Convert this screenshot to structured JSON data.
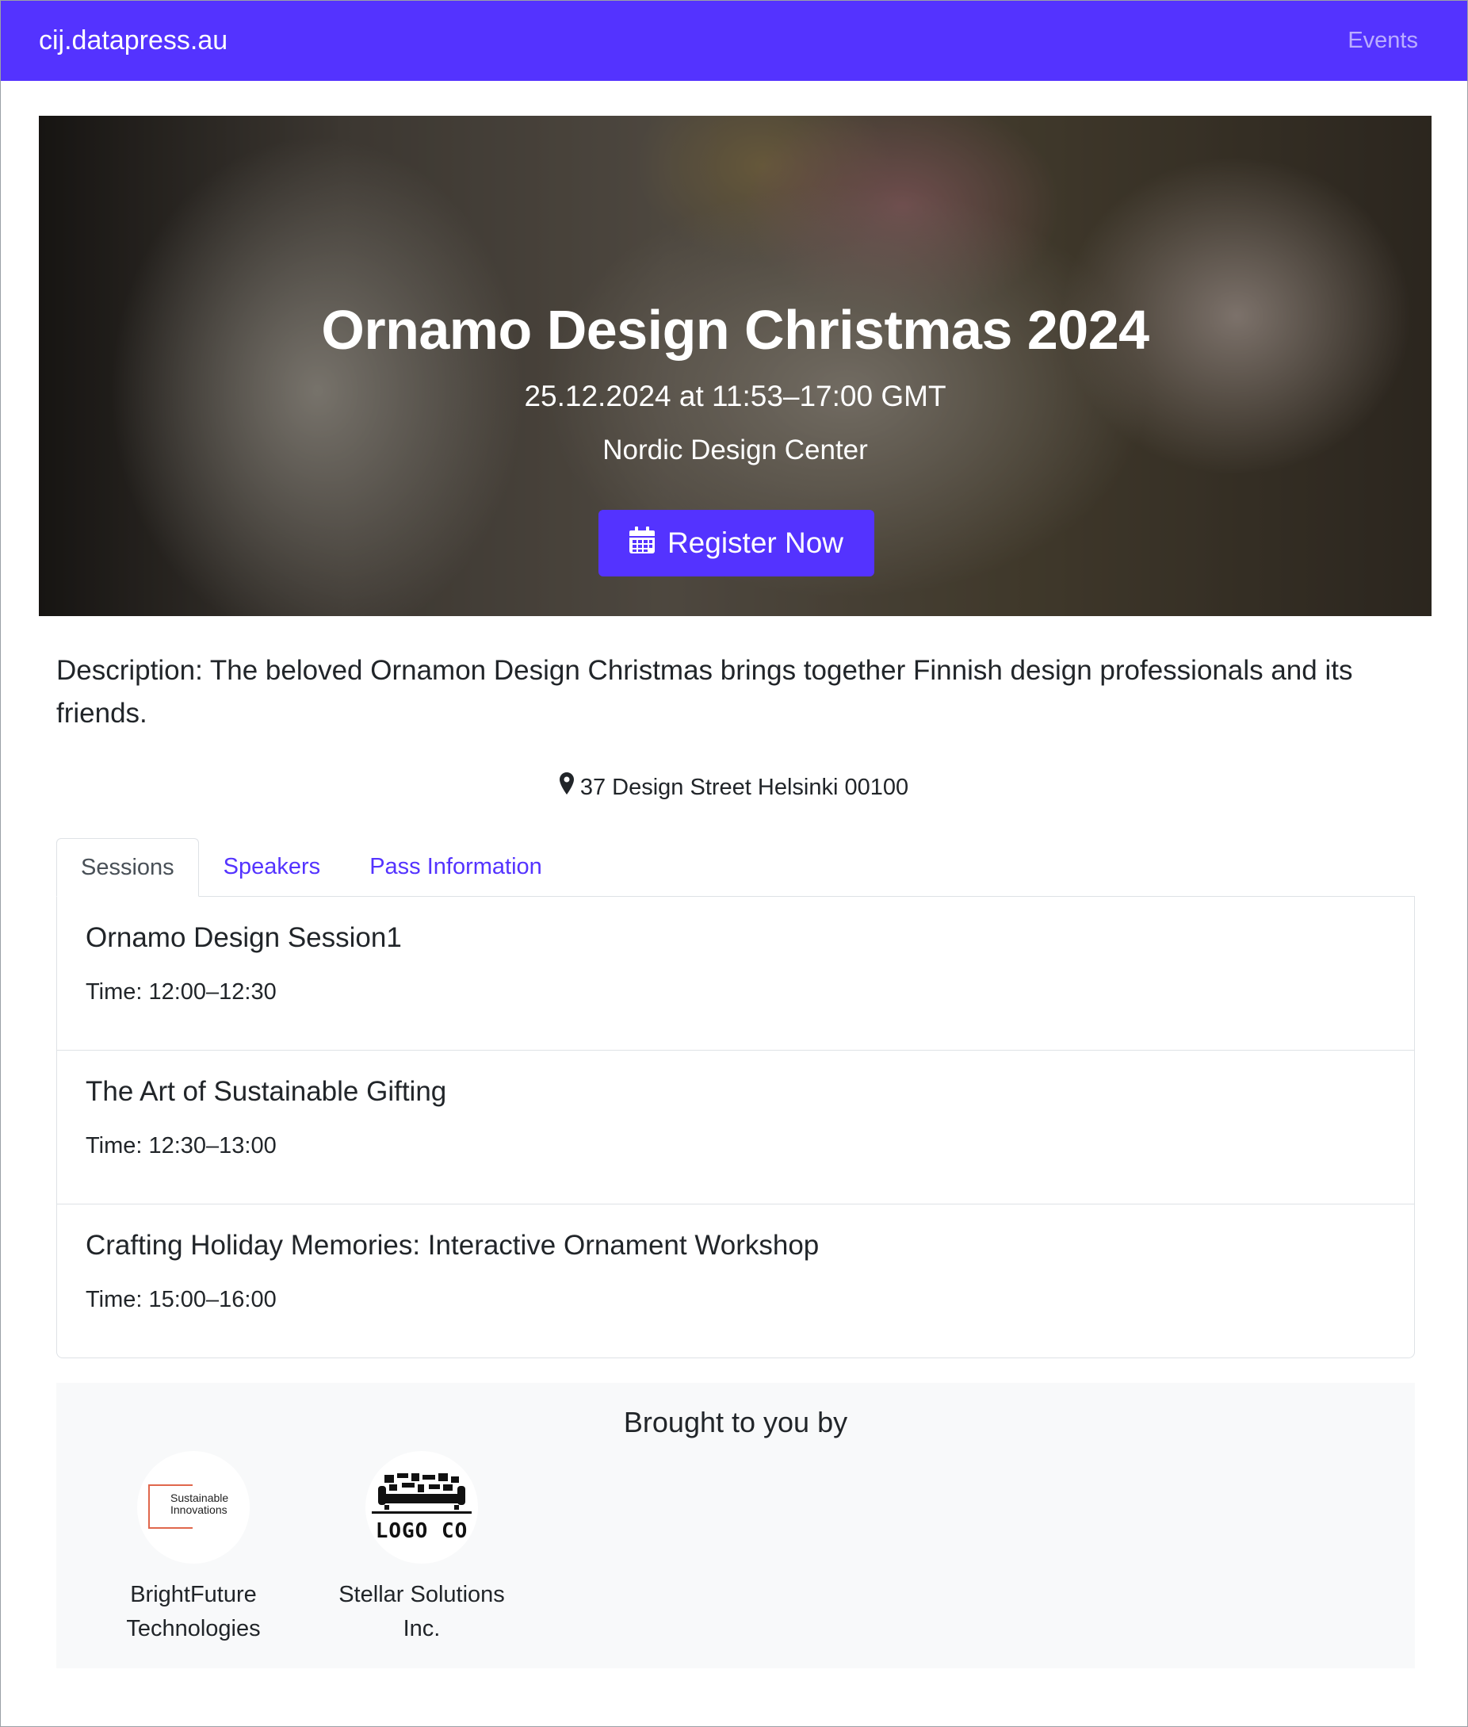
{
  "navbar": {
    "brand": "cij.datapress.au",
    "events_link": "Events"
  },
  "hero": {
    "title": "Ornamo Design Christmas 2024",
    "datetime": "25.12.2024 at 11:53–17:00 GMT",
    "venue": "Nordic Design Center",
    "register_label": "Register Now",
    "register_icon": "calendar-icon"
  },
  "description": "Description: The beloved Ornamon Design Christmas brings together Finnish design professionals and its friends.",
  "address": {
    "icon": "map-marker-icon",
    "text": "37 Design Street Helsinki 00100"
  },
  "tabs": [
    {
      "label": "Sessions",
      "active": true
    },
    {
      "label": "Speakers",
      "active": false
    },
    {
      "label": "Pass Information",
      "active": false
    }
  ],
  "sessions": [
    {
      "title": "Ornamo Design Session1",
      "time": "Time: 12:00–12:30"
    },
    {
      "title": "The Art of Sustainable Gifting",
      "time": "Time: 12:30–13:00"
    },
    {
      "title": "Crafting Holiday Memories: Interactive Ornament Workshop",
      "time": "Time: 15:00–16:00"
    }
  ],
  "sponsors": {
    "heading": "Brought to you by",
    "items": [
      {
        "name": "BrightFuture Technologies",
        "logo_text": "Sustainable Innovations"
      },
      {
        "name": "Stellar Solutions Inc.",
        "logo_text": "LOGO CO"
      }
    ]
  },
  "colors": {
    "primary": "#5433ff",
    "sponsor_bg": "#f8f9fa"
  }
}
